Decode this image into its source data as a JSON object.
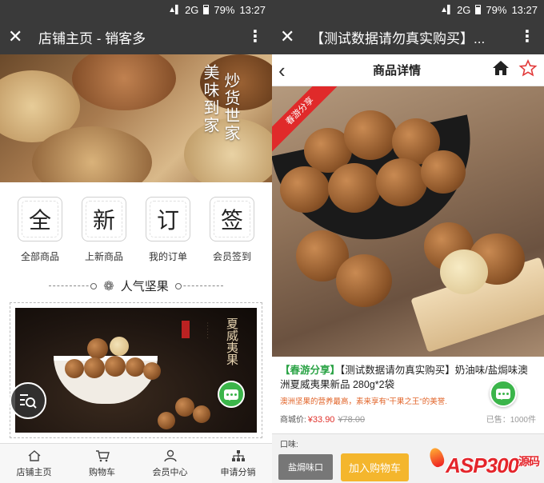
{
  "status": {
    "network": "2G",
    "battery": "79%",
    "time": "13:27"
  },
  "left": {
    "title": "店铺主页 - 销客多",
    "banner": {
      "line1": "炒货世家",
      "line2": "美味到家"
    },
    "quicknav": [
      {
        "char": "全",
        "label": "全部商品"
      },
      {
        "char": "新",
        "label": "上新商品"
      },
      {
        "char": "订",
        "label": "我的订单"
      },
      {
        "char": "签",
        "label": "会员签到"
      }
    ],
    "section_title": "人气坚果",
    "product_banner_text": "夏威夷果",
    "tabs": [
      {
        "label": "店铺主页",
        "icon": "home-icon"
      },
      {
        "label": "购物车",
        "icon": "cart-icon"
      },
      {
        "label": "会员中心",
        "icon": "user-icon"
      },
      {
        "label": "申请分销",
        "icon": "network-icon"
      }
    ]
  },
  "right": {
    "title": "【测试数据请勿真实购买】...",
    "header_title": "商品详情",
    "ribbon": "春游分享",
    "product": {
      "tag": "【春游分享】",
      "name": "【测试数据请勿真实购买】奶油味/盐焗味澳洲夏威夷果新品 280g*2袋",
      "desc": "澳洲坚果的营养最高，素来享有\"干果之王\"的美誉.",
      "price_label": "商城价:",
      "price": "¥33.90",
      "old_price": "¥78.00",
      "sold": "已售：1000件"
    },
    "option_label": "口味:",
    "option_value": "盐焗味口",
    "add_cart": "加入购物车",
    "watermark": "ASP300",
    "watermark_suffix": "源码"
  },
  "colors": {
    "titlebar": "#3a3a3a",
    "accent_green": "#3bb54a",
    "price_red": "#e0302a",
    "add_cart_yellow": "#f4b62d"
  }
}
